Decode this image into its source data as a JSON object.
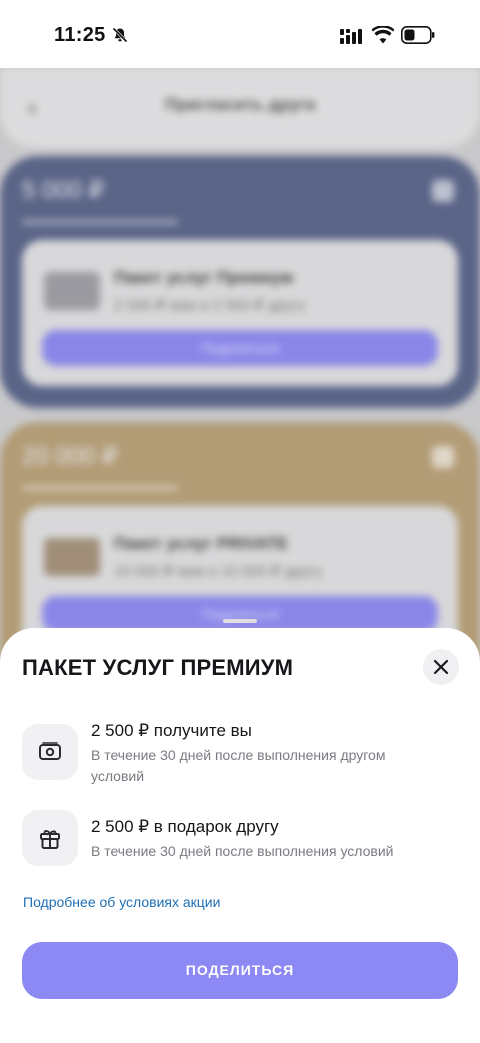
{
  "status_bar": {
    "time": "11:25"
  },
  "background": {
    "title": "Пригласить друга",
    "cards": [
      {
        "amount": "5 000 ₽",
        "package": "Пакет услуг Премиум",
        "bonus": "2 500 ₽ вам и 2 500 ₽ другу",
        "button": "Поделиться"
      },
      {
        "amount": "20 000 ₽",
        "package": "Пакет услуг PRIVATE",
        "bonus": "10 000 ₽ вам и 10 000 ₽ другу",
        "button": "Поделиться"
      }
    ]
  },
  "sheet": {
    "title": "ПАКЕТ УСЛУГ ПРЕМИУМ",
    "benefits": [
      {
        "icon": "cash-icon",
        "title": "2 500 ₽ получите вы",
        "description": "В течение 30 дней после выполнения другом условий"
      },
      {
        "icon": "gift-icon",
        "title": "2 500 ₽ в подарок другу",
        "description": "В течение 30 дней после выполнения условий"
      }
    ],
    "link": "Подробнее об условиях акции",
    "share_button": "ПОДЕЛИТЬСЯ"
  },
  "colors": {
    "accent": "#8C89F4",
    "link": "#1F6FB5",
    "card_blue": "#5A6487",
    "card_gold": "#B29C76"
  }
}
